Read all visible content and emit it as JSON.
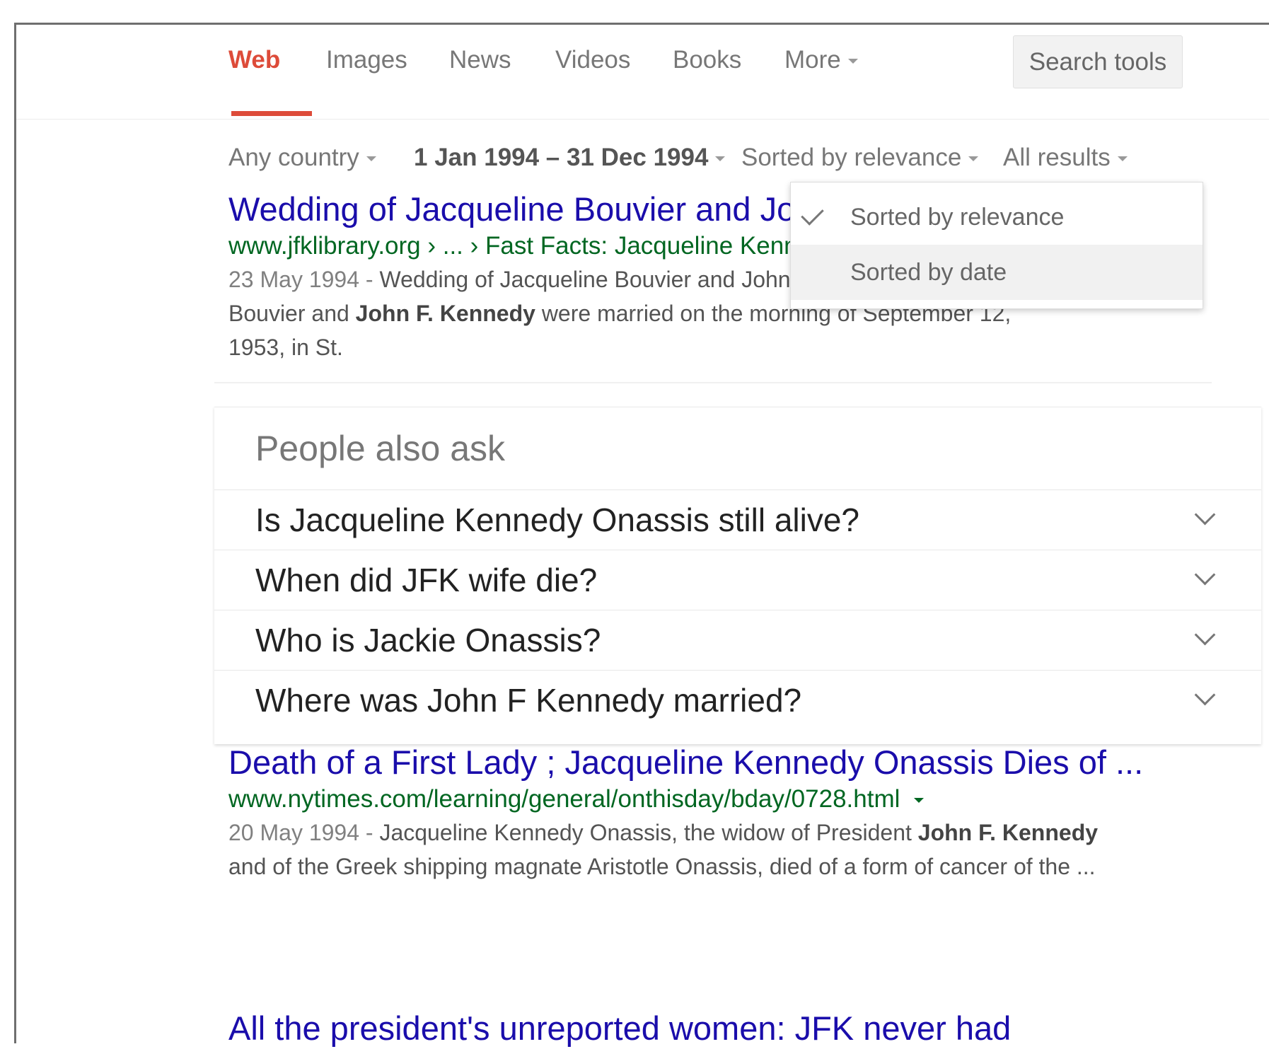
{
  "tabs": {
    "web": "Web",
    "images": "Images",
    "news": "News",
    "videos": "Videos",
    "books": "Books",
    "more": "More",
    "search_tools": "Search tools"
  },
  "tools": {
    "country": "Any country",
    "date_range": "1 Jan 1994 – 31 Dec 1994",
    "sort": "Sorted by relevance",
    "results": "All results"
  },
  "sort_menu": {
    "option_relevance": "Sorted by relevance",
    "option_date": "Sorted by date",
    "selected": "Sorted by relevance"
  },
  "results": [
    {
      "title": "Wedding of Jacqueline Bouvier and John F. Kennedy",
      "url": "www.jfklibrary.org › ... › Fast Facts: Jacqueline Kennedy",
      "date": "23 May 1994",
      "dash": " - ",
      "snippet_a": "Wedding of Jacqueline Bouvier and John F. Kennedy. Jacqueline Lee",
      "snippet_b": "Bouvier and ",
      "snippet_b_bold": "John F. Kennedy",
      "snippet_c": " were married on the morning of September 12, 1953, in St."
    },
    {
      "title": "Death of a First Lady ; Jacqueline Kennedy Onassis Dies of ...",
      "url": "www.nytimes.com/learning/general/onthisday/bday/0728.html",
      "date": "20 May 1994",
      "dash": " - ",
      "snippet_a": "Jacqueline Kennedy Onassis, the widow of President ",
      "snippet_a_bold": "John F. Kennedy",
      "snippet_b": "and of the Greek shipping magnate Aristotle Onassis, died of a form of cancer of the ..."
    }
  ],
  "paa": {
    "heading": "People also ask",
    "questions": [
      "Is Jacqueline Kennedy Onassis still alive?",
      "When did JFK wife die?",
      "Who is Jackie Onassis?",
      "Where was John F Kennedy married?"
    ]
  },
  "partial_result_title": "All the president's unreported women: JFK never had"
}
